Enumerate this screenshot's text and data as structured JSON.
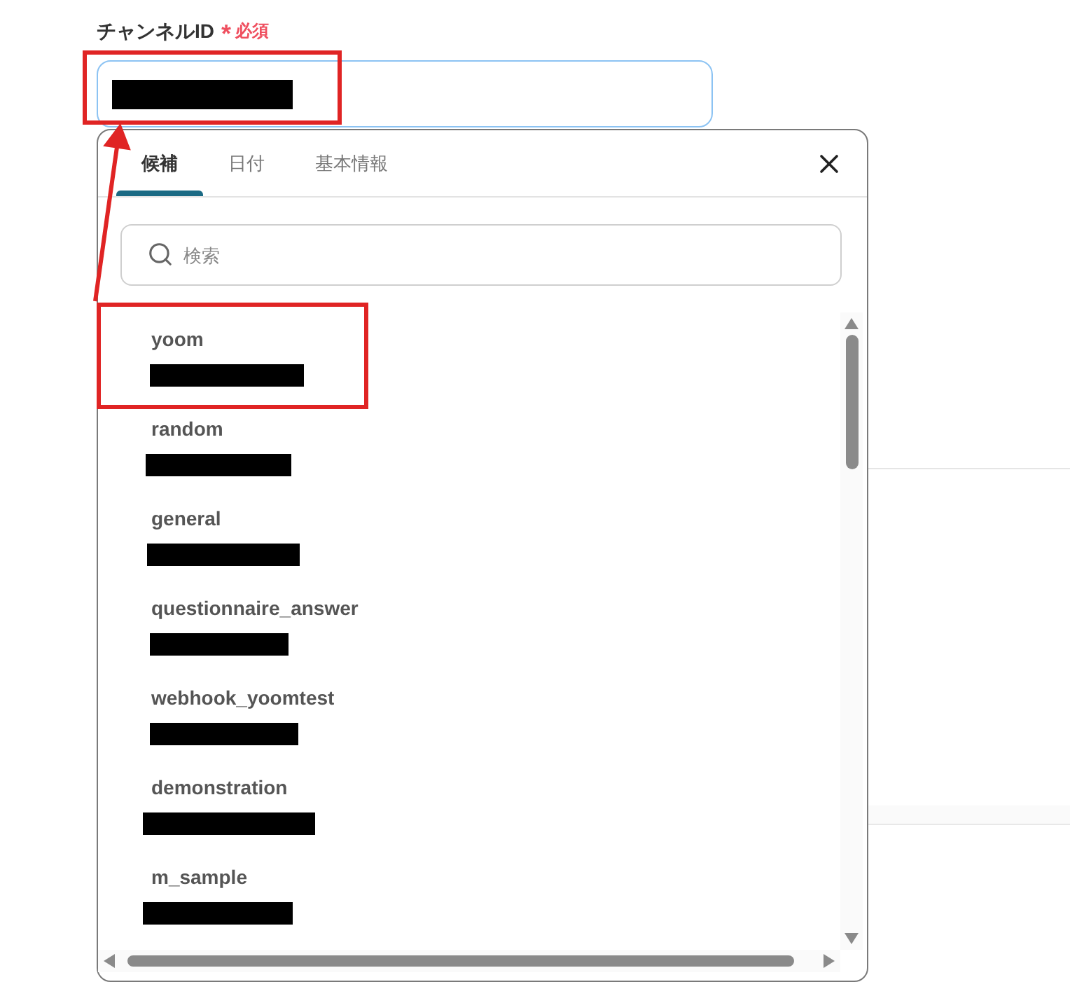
{
  "field": {
    "label": "チャンネルID",
    "required_mark": "*",
    "required_label": "必須",
    "value_redacted": true,
    "focused": true,
    "highlighted": true
  },
  "popup": {
    "tabs": [
      {
        "label": "候補",
        "selected": true
      },
      {
        "label": "日付",
        "selected": false
      },
      {
        "label": "基本情報",
        "selected": false
      }
    ],
    "search": {
      "placeholder": "検索"
    },
    "items": [
      {
        "name": "yoom",
        "id_redacted": true,
        "highlighted": true
      },
      {
        "name": "random",
        "id_redacted": true,
        "highlighted": false
      },
      {
        "name": "general",
        "id_redacted": true,
        "highlighted": false
      },
      {
        "name": "questionnaire_answer",
        "id_redacted": true,
        "highlighted": false
      },
      {
        "name": "webhook_yoomtest",
        "id_redacted": true,
        "highlighted": false
      },
      {
        "name": "demonstration",
        "id_redacted": true,
        "highlighted": false
      },
      {
        "name": "m_sample",
        "id_redacted": true,
        "highlighted": false
      }
    ]
  },
  "annotation_arrow": true
}
